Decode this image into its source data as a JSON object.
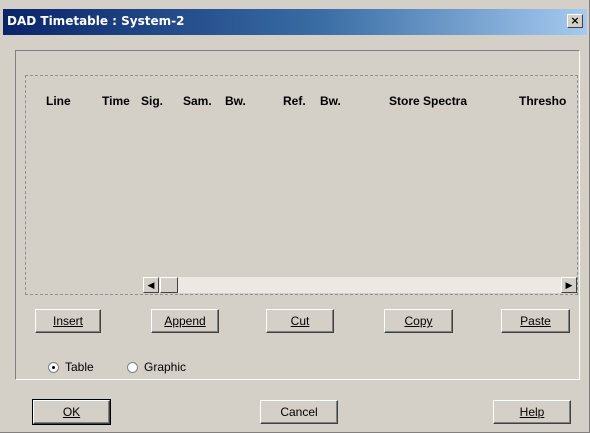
{
  "window": {
    "title": "DAD Timetable : System-2",
    "close_glyph": "×"
  },
  "table": {
    "columns": [
      "Line",
      "Time",
      "Sig.",
      "Sam.",
      "Bw.",
      "Ref.",
      "Bw.",
      "Store Spectra",
      "Thresho"
    ]
  },
  "scrollbar": {
    "left_arrow": "◀",
    "right_arrow": "▶"
  },
  "edit_buttons": {
    "insert": "Insert",
    "append": "Append",
    "cut": "Cut",
    "copy": "Copy",
    "paste": "Paste"
  },
  "view_mode": {
    "table": "Table",
    "graphic": "Graphic",
    "selected": "Table"
  },
  "footer_buttons": {
    "ok": "OK",
    "cancel": "Cancel",
    "help": "Help"
  }
}
